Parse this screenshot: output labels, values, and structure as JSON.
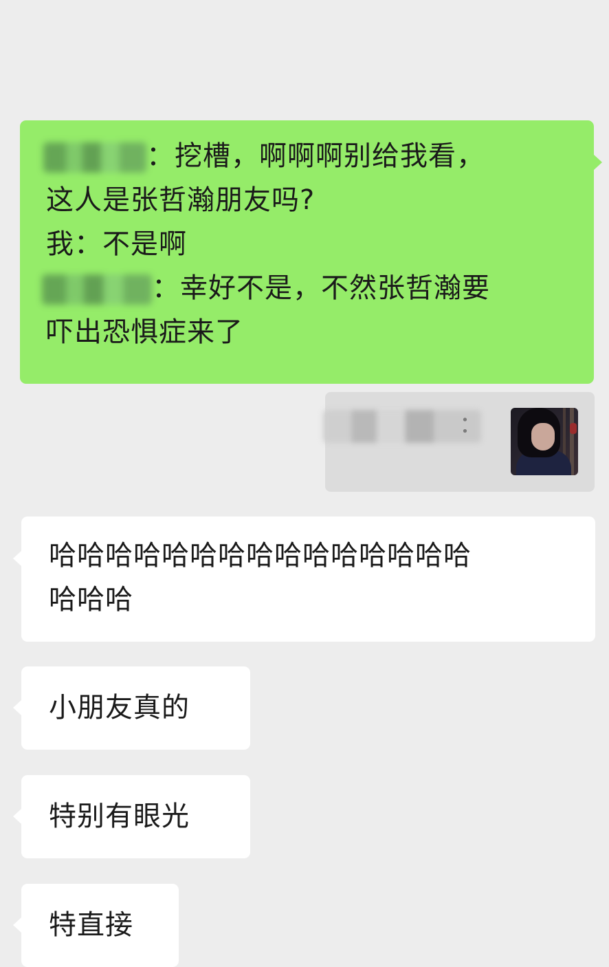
{
  "colors": {
    "background": "#ededed",
    "sent_bubble": "#95ec69",
    "received_bubble": "#ffffff",
    "quote_box": "#dcdcdc"
  },
  "sent_message": {
    "line1_text": "：挖槽，啊啊啊别给我看，",
    "line2_text": "这人是张哲瀚朋友吗?",
    "line3_text": "我：不是啊",
    "line4_text": "：幸好不是，不然张哲瀚要",
    "line5_text": "吓出恐惧症来了"
  },
  "quote": {
    "colon": "：",
    "thumbnail_icon": "photo-thumbnail"
  },
  "received_messages": [
    {
      "lines": [
        "哈哈哈哈哈哈哈哈哈哈哈哈哈哈哈",
        "哈哈哈"
      ]
    },
    {
      "lines": [
        "小朋友真的"
      ]
    },
    {
      "lines": [
        "特别有眼光"
      ]
    },
    {
      "lines": [
        "特直接"
      ]
    }
  ]
}
